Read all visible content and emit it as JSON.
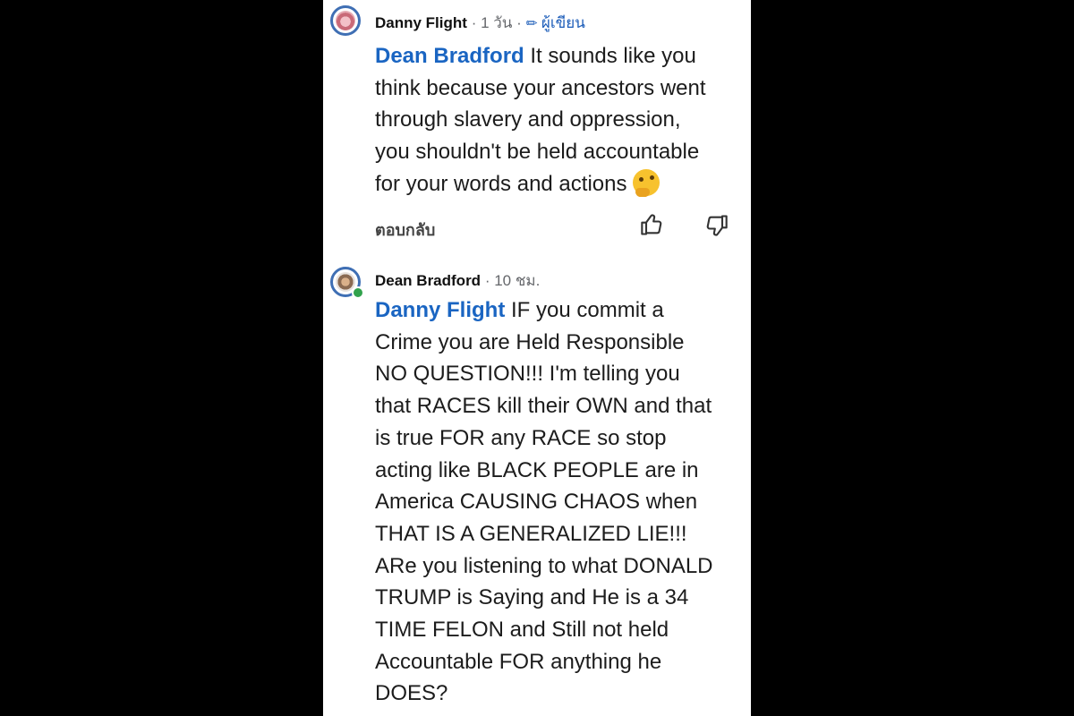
{
  "comments": [
    {
      "author": "Danny Flight",
      "time": "1 วัน",
      "author_tag": "ผู้เขียน",
      "mention": "Dean Bradford",
      "lines": [
        " It sounds like you",
        "think because your ancestors went",
        "through slavery and oppression,",
        "you shouldn't be held accountable",
        "for your words and actions "
      ],
      "reply_label": "ตอบกลับ",
      "emoji_icon": "thinking-face-emoji"
    },
    {
      "author": "Dean Bradford",
      "time": "10 ชม.",
      "mention": "Danny Flight",
      "lines": [
        " IF you commit a",
        "Crime you are Held Responsible",
        "NO QUESTION!!! I'm telling you",
        "that RACES kill their OWN and that",
        "is true FOR any RACE so stop",
        "acting like BLACK PEOPLE are in",
        "America CAUSING CHAOS when",
        "THAT IS A GENERALIZED LIE!!!",
        "ARe you listening to what DONALD",
        "TRUMP is Saying and He is a 34",
        "TIME FELON and Still not held",
        "Accountable FOR anything he",
        "DOES?"
      ]
    }
  ],
  "colors": {
    "mention": "#1a65c2",
    "online": "#31a24c",
    "background": "#000000"
  },
  "icons": [
    "thumbs-up-icon",
    "thumbs-down-icon",
    "pencil-icon"
  ]
}
